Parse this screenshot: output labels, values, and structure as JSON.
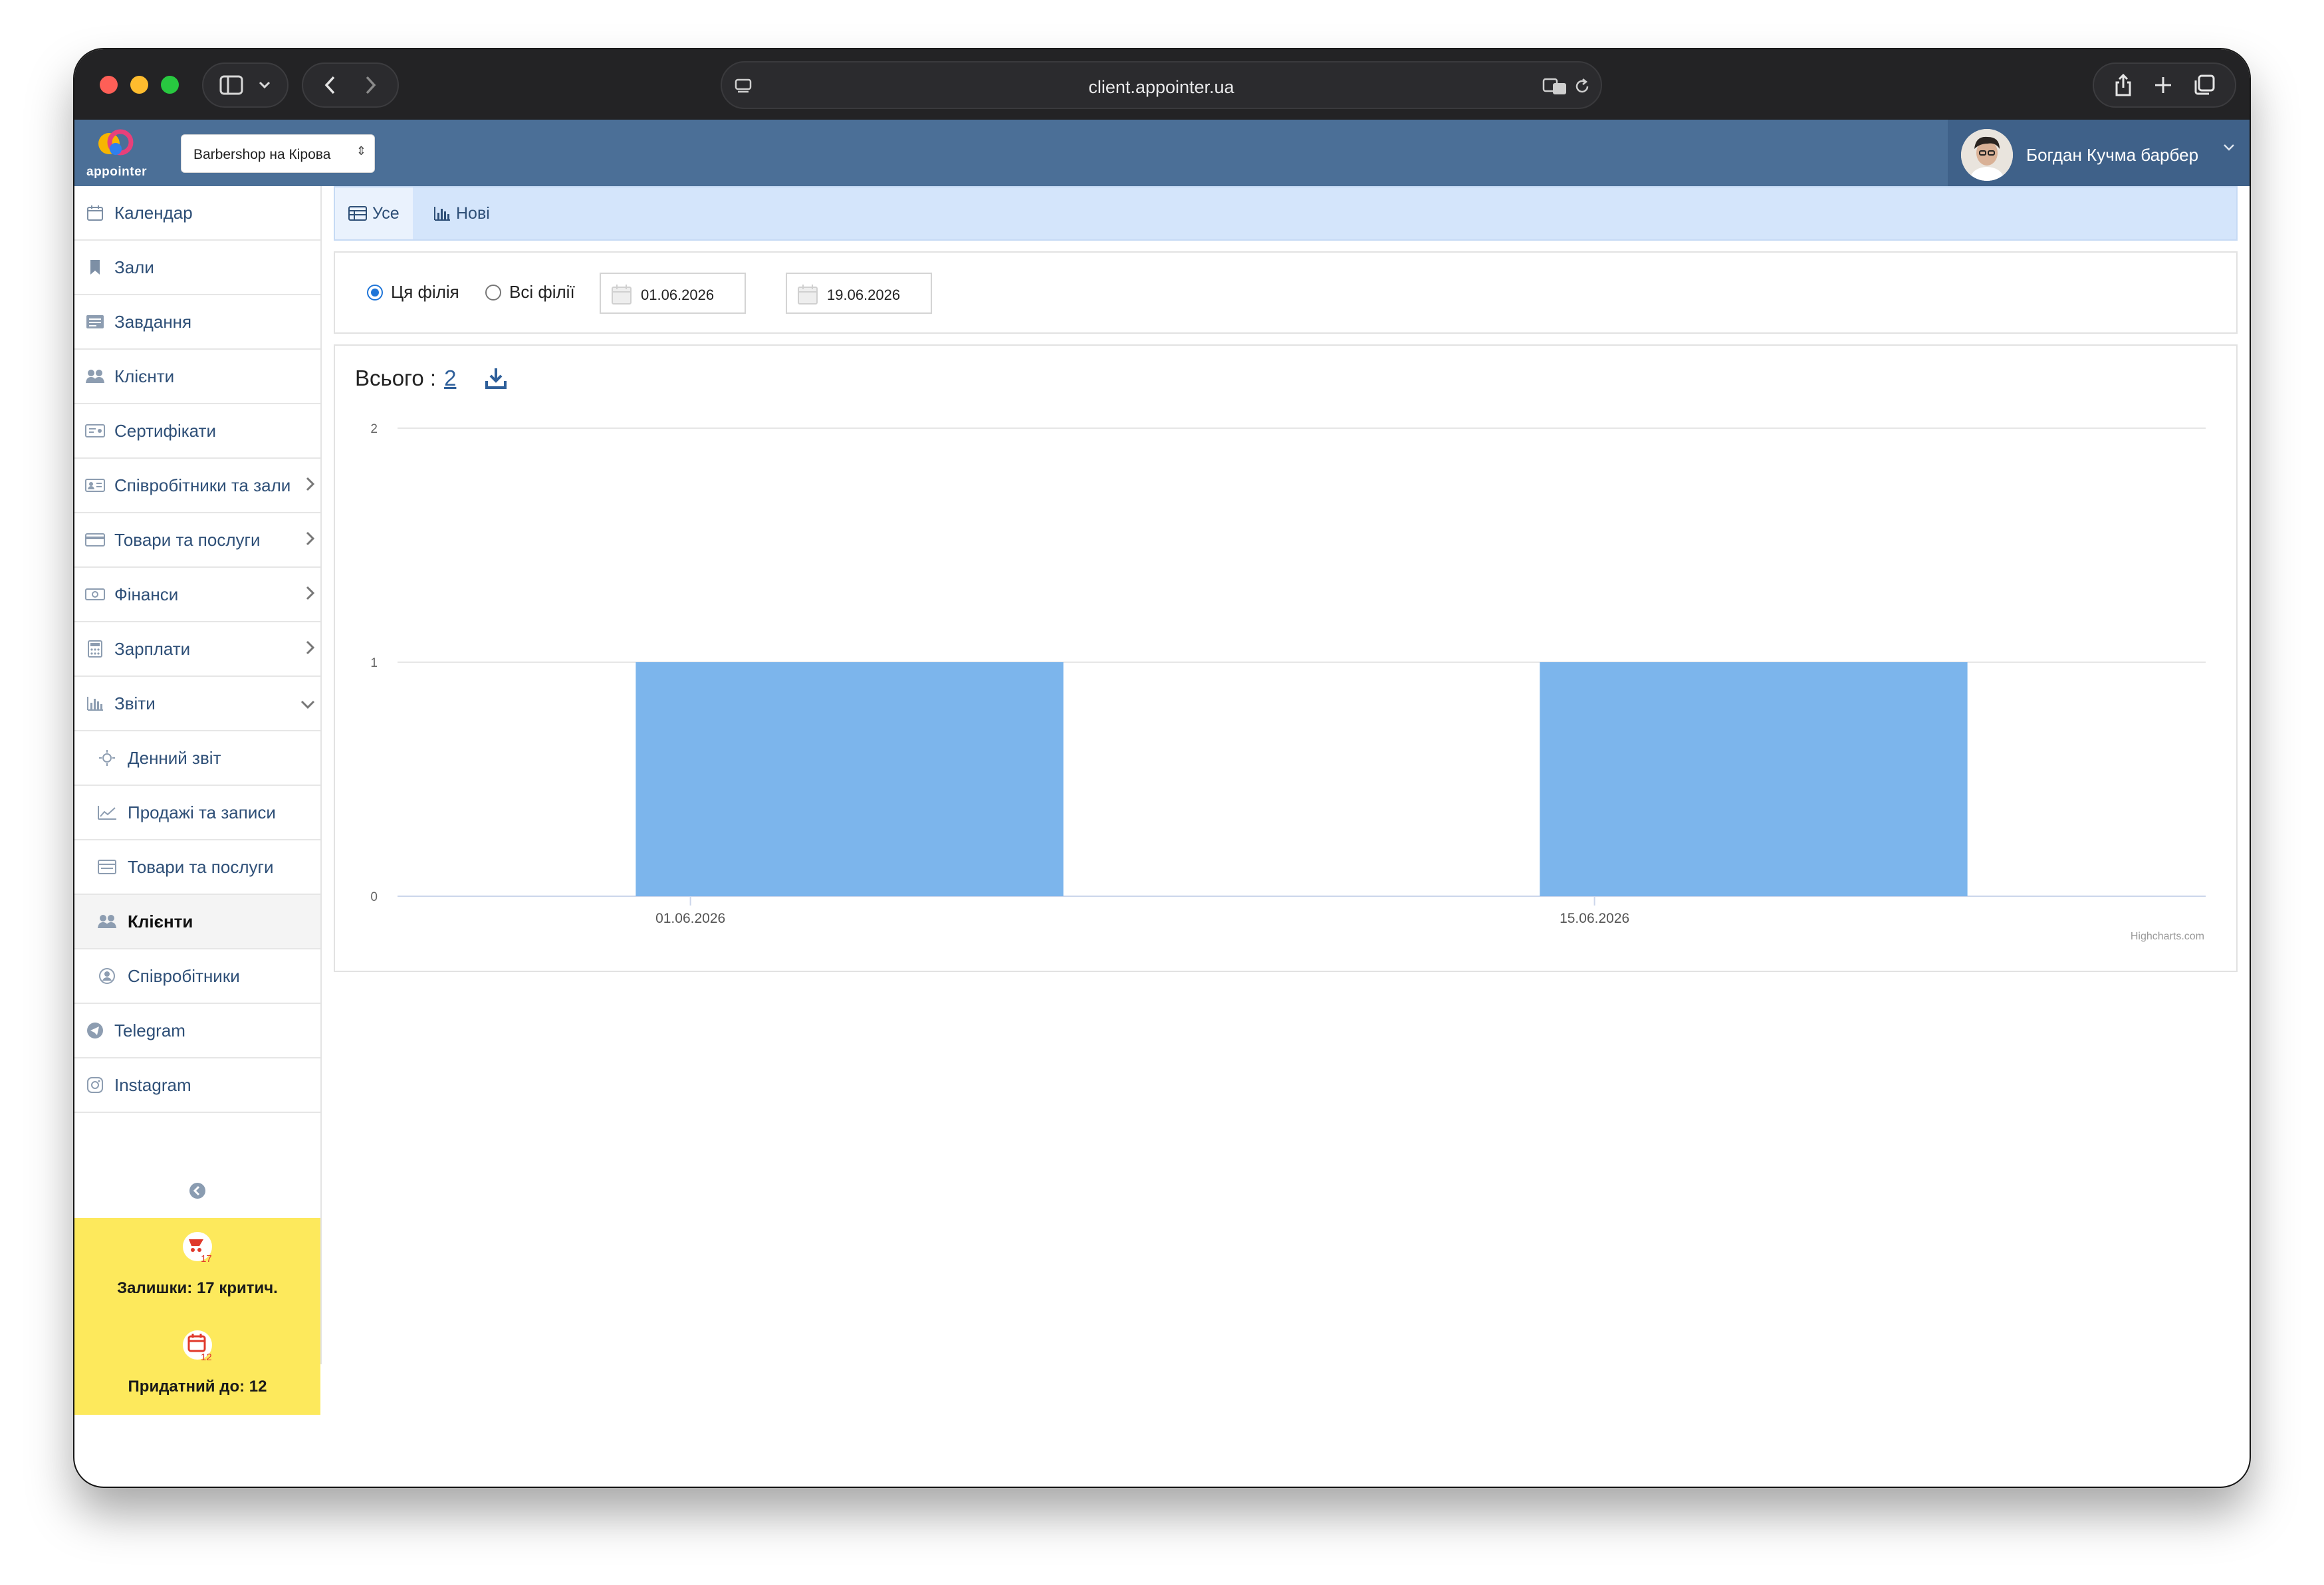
{
  "browser": {
    "url": "client.appointer.ua"
  },
  "app": {
    "logo_text": "appointer",
    "branch": "Barbershop на Кірова",
    "user_name": "Богдан Кучма барбер"
  },
  "sidebar": {
    "items": [
      {
        "label": "Календар",
        "icon": "calendar-icon"
      },
      {
        "label": "Зали",
        "icon": "bookmark-icon"
      },
      {
        "label": "Завдання",
        "icon": "tasks-icon"
      },
      {
        "label": "Клієнти",
        "icon": "users-icon"
      },
      {
        "label": "Сертифікати",
        "icon": "certificate-icon"
      },
      {
        "label": "Співробітники та зали",
        "icon": "id-card-icon",
        "has_chevron": true
      },
      {
        "label": "Товари та послуги",
        "icon": "credit-card-icon",
        "has_chevron": true
      },
      {
        "label": "Фінанси",
        "icon": "money-icon",
        "has_chevron": true
      },
      {
        "label": "Зарплати",
        "icon": "calculator-icon",
        "has_chevron": true
      },
      {
        "label": "Звіти",
        "icon": "bar-chart-icon",
        "expanded": true
      }
    ],
    "sub_items": [
      {
        "label": "Денний звіт",
        "icon": "sun-icon"
      },
      {
        "label": "Продажі та записи",
        "icon": "line-chart-icon"
      },
      {
        "label": "Товари та послуги",
        "icon": "list-icon"
      },
      {
        "label": "Клієнти",
        "icon": "users-icon",
        "active": true
      },
      {
        "label": "Співробітники",
        "icon": "user-circle-icon"
      }
    ],
    "bottom_items": [
      {
        "label": "Telegram",
        "icon": "telegram-icon"
      },
      {
        "label": "Instagram",
        "icon": "instagram-icon"
      }
    ],
    "alerts": [
      {
        "text": "Залишки: 17 критич.",
        "badge": "17",
        "icon": "stock-alert-icon"
      },
      {
        "text": "Придатний до: 12",
        "badge": "12",
        "icon": "expiry-calendar-icon"
      }
    ]
  },
  "tabs": [
    {
      "label": "Усе",
      "icon": "table-icon",
      "selected": true
    },
    {
      "label": "Нові",
      "icon": "bar-chart-icon",
      "selected": false
    }
  ],
  "filters": {
    "scope_options": [
      {
        "label": "Ця філія",
        "checked": true
      },
      {
        "label": "Всі філії",
        "checked": false
      }
    ],
    "date_from": "01.06.2026",
    "date_to": "19.06.2026"
  },
  "summary": {
    "total_label": "Всього :",
    "total_value": "2"
  },
  "chart_data": {
    "type": "bar",
    "categories": [
      "01.06.2026",
      "15.06.2026"
    ],
    "values": [
      1,
      1
    ],
    "ylim": [
      0,
      2
    ],
    "yticks": [
      0,
      1,
      2
    ],
    "bar_color": "#7cb5ec",
    "grid": true,
    "credit": "Highcharts.com"
  },
  "colors": {
    "header": "#4b6f97",
    "accent": "#2e4f77",
    "alert_bg": "#fde95c",
    "tab_bar": "#d4e5fb"
  }
}
